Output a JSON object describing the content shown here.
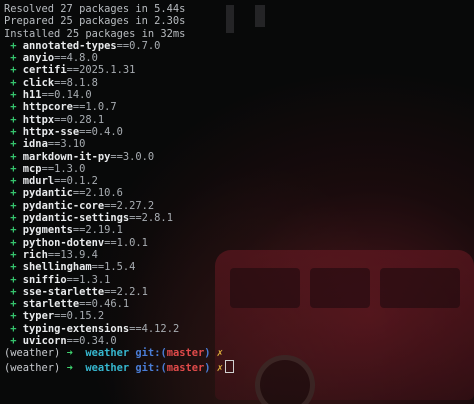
{
  "summary": [
    "Resolved 27 packages in 5.44s",
    "Prepared 25 packages in 2.30s",
    "Installed 25 packages in 32ms"
  ],
  "install_marker": "+",
  "packages": [
    {
      "name": "annotated-types",
      "version": "==0.7.0"
    },
    {
      "name": "anyio",
      "version": "==4.8.0"
    },
    {
      "name": "certifi",
      "version": "==2025.1.31"
    },
    {
      "name": "click",
      "version": "==8.1.8"
    },
    {
      "name": "h11",
      "version": "==0.14.0"
    },
    {
      "name": "httpcore",
      "version": "==1.0.7"
    },
    {
      "name": "httpx",
      "version": "==0.28.1"
    },
    {
      "name": "httpx-sse",
      "version": "==0.4.0"
    },
    {
      "name": "idna",
      "version": "==3.10"
    },
    {
      "name": "markdown-it-py",
      "version": "==3.0.0"
    },
    {
      "name": "mcp",
      "version": "==1.3.0"
    },
    {
      "name": "mdurl",
      "version": "==0.1.2"
    },
    {
      "name": "pydantic",
      "version": "==2.10.6"
    },
    {
      "name": "pydantic-core",
      "version": "==2.27.2"
    },
    {
      "name": "pydantic-settings",
      "version": "==2.8.1"
    },
    {
      "name": "pygments",
      "version": "==2.19.1"
    },
    {
      "name": "python-dotenv",
      "version": "==1.0.1"
    },
    {
      "name": "rich",
      "version": "==13.9.4"
    },
    {
      "name": "shellingham",
      "version": "==1.5.4"
    },
    {
      "name": "sniffio",
      "version": "==1.3.1"
    },
    {
      "name": "sse-starlette",
      "version": "==2.2.1"
    },
    {
      "name": "starlette",
      "version": "==0.46.1"
    },
    {
      "name": "typer",
      "version": "==0.15.2"
    },
    {
      "name": "typing-extensions",
      "version": "==4.12.2"
    },
    {
      "name": "uvicorn",
      "version": "==0.34.0"
    }
  ],
  "prompts": [
    {
      "env": "(weather)",
      "arrow": "➜",
      "cwd": "weather",
      "git_label": "git:(",
      "branch": "master",
      "git_close": ")",
      "dirty": "✗"
    },
    {
      "env": "(weather)",
      "arrow": "➜",
      "cwd": "weather",
      "git_label": "git:(",
      "branch": "master",
      "git_close": ")",
      "dirty": "✗"
    }
  ],
  "colors": {
    "background": "#080909",
    "plus": "#35c46d",
    "arrow": "#3fd46f",
    "cwd": "#36b7cf",
    "git": "#4a7dd6",
    "branch": "#e04a4a",
    "dirty": "#e0b43c"
  }
}
